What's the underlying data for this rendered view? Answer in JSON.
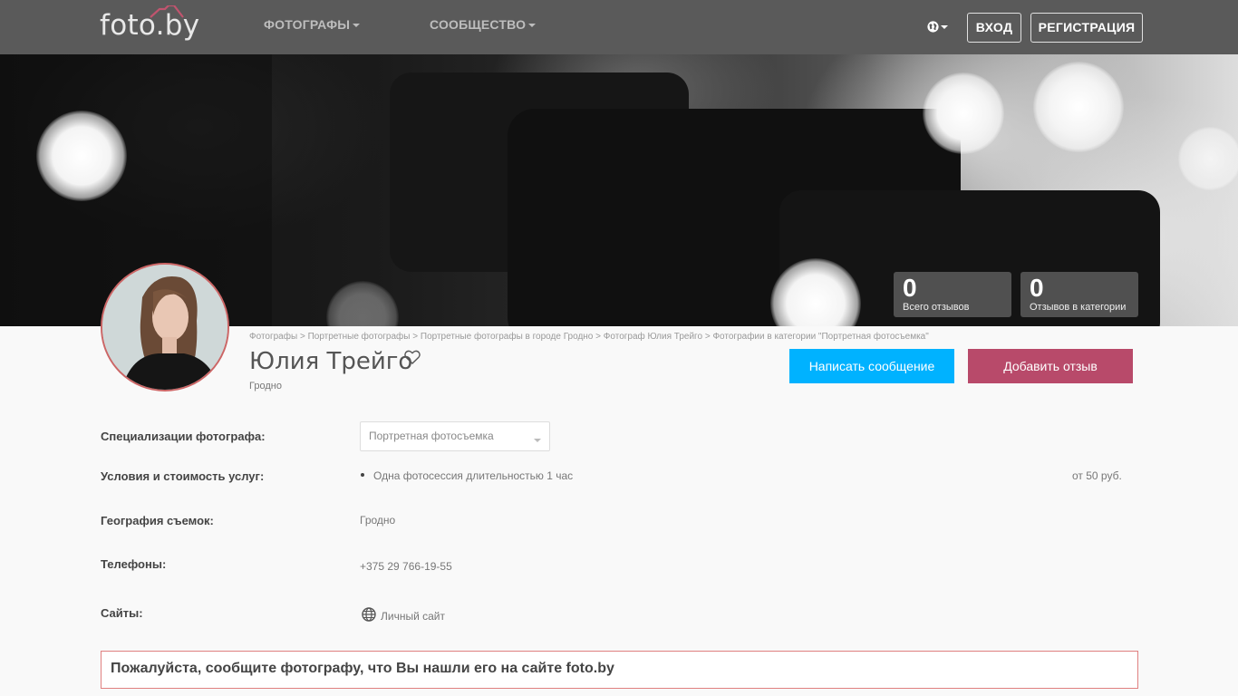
{
  "navbar": {
    "logo": "foto.by",
    "menu": [
      {
        "label": "ФОТОГРАФЫ"
      },
      {
        "label": "СООБЩЕСТВО"
      }
    ],
    "login_label": "ВХОД",
    "register_label": "РЕГИСТРАЦИЯ"
  },
  "stats": [
    {
      "value": "0",
      "label": "Всего отзывов"
    },
    {
      "value": "0",
      "label": "Отзывов в категории"
    }
  ],
  "breadcrumb": [
    "Фотографы",
    "Портретные фотографы",
    "Портретные фотографы в городе Гродно",
    "Фотограф Юлия Трейго",
    "Фотографии в категории \"Портретная фотосъемка\""
  ],
  "breadcrumb_separator": ">",
  "profile": {
    "name": "Юлия Трейго",
    "city": "Гродно"
  },
  "actions": {
    "message_label": "Написать сообщение",
    "review_label": "Добавить отзыв"
  },
  "info": {
    "specializations_label": "Специализации фотографа:",
    "specialization_selected": "Портретная фотосъемка",
    "services_label": "Условия и стоимость услуг:",
    "service_item": "Одна фотосессия длительностью 1 час",
    "service_price": "от 50 руб.",
    "geography_label": "География съемок:",
    "geography_value": "Гродно",
    "phones_label": "Телефоны:",
    "phone_value": "+375 29 766-19-55",
    "sites_label": "Сайты:",
    "site_value": "Личный сайт"
  },
  "notice": "Пожалуйста, сообщите фотографу, что Вы нашли его на сайте foto.by",
  "icons": [
    "camera-roof-icon",
    "globe-icon",
    "heart-icon",
    "caret-down-icon"
  ],
  "colors": {
    "navbar": "#5a5a5a",
    "message_button": "#00b2ff",
    "review_button": "#b84a6a",
    "notice_border": "#e08080"
  }
}
